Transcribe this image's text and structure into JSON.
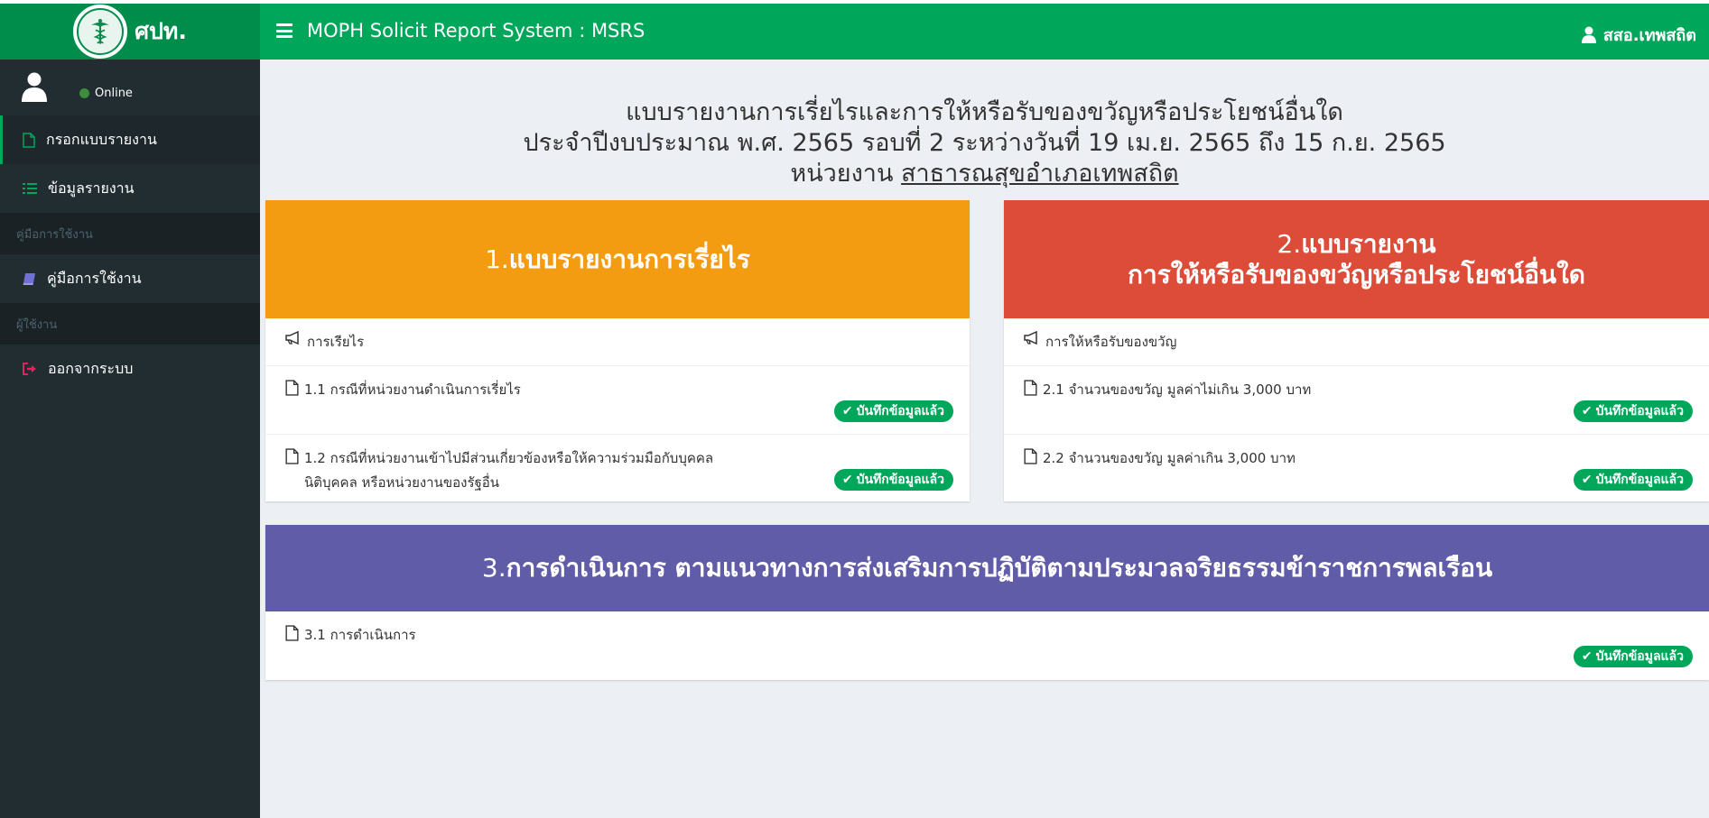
{
  "header": {
    "brand": "ศปท.",
    "app_title": "MOPH Solicit Report System : MSRS",
    "user": "สสอ.เทพสถิต"
  },
  "sidebar": {
    "status": "Online",
    "items": [
      {
        "label": "กรอกแบบรายงาน"
      },
      {
        "label": "ข้อมูลรายงาน"
      }
    ],
    "headers": [
      "คู่มือการใช้งาน",
      "ผู้ใช้งาน"
    ],
    "manual": "คู่มือการใช้งาน",
    "logout": "ออกจากระบบ"
  },
  "page": {
    "line1": "แบบรายงานการเรี่ยไรและการให้หรือรับของขวัญหรือประโยชน์อื่นใด",
    "line2": "ประจำปีงบประมาณ พ.ศ. 2565 รอบที่ 2 ระหว่างวันที่ 19 เม.ย. 2565 ถึง 15 ก.ย. 2565",
    "unit_prefix": "หน่วยงาน ",
    "unit_name": "สาธารณสุขอำเภอเทพสถิต"
  },
  "badge_label": "บันทึกข้อมูลแล้ว",
  "boxes": [
    {
      "num": "1.",
      "title": "แบบรายงานการเรี่ยไร",
      "color": "#f39c12",
      "subheader": "การเรียไร",
      "rows": [
        {
          "text": "1.1 กรณีที่หน่วยงานดำเนินการเรี่ยไร"
        },
        {
          "text": "1.2 กรณีที่หน่วยงานเข้าไปมีส่วนเกี่ยวข้องหรือให้ความร่วมมือกับบุคคล",
          "text2": "นิติบุคคล หรือหน่วยงานของรัฐอื่น"
        }
      ]
    },
    {
      "num": "2.",
      "title": "แบบรายงาน",
      "title2": "การให้หรือรับของขวัญหรือประโยชน์อื่นใด",
      "color": "#dd4b39",
      "subheader": "การให้หรือรับของขวัญ",
      "rows": [
        {
          "text": "2.1 จำนวนของขวัญ มูลค่าไม่เกิน 3,000 บาท"
        },
        {
          "text": "2.2 จำนวนของขวัญ มูลค่าเกิน 3,000 บาท"
        }
      ]
    },
    {
      "num": "3.",
      "title": "การดำเนินการ ตามแนวทางการส่งเสริมการปฏิบัติตามประมวลจริยธรรมข้าราชการพลเรือน",
      "color": "#605ca8",
      "rows": [
        {
          "text": "3.1 การดำเนินการ"
        }
      ]
    }
  ]
}
